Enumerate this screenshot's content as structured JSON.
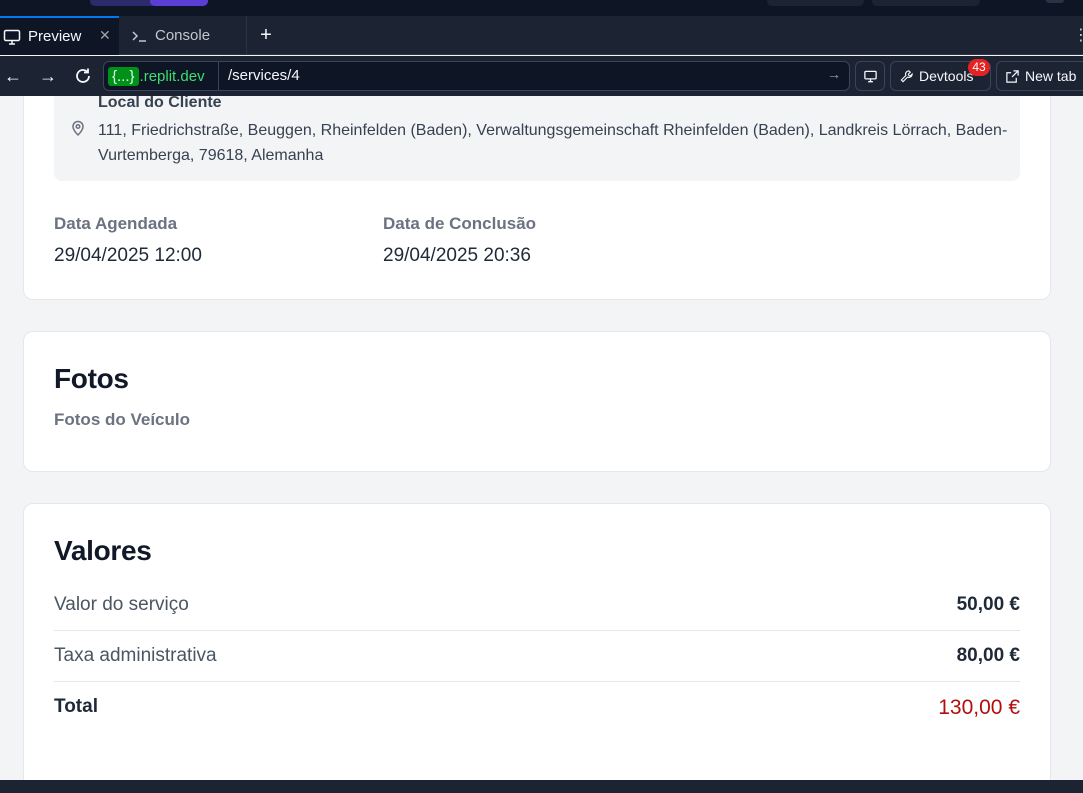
{
  "browser": {
    "tabs": [
      {
        "label": "Preview",
        "icon": "monitor-icon",
        "active": true
      },
      {
        "label": "Console",
        "icon": "terminal-icon",
        "active": false
      }
    ],
    "url": {
      "host_braces": "{...}",
      "host_domain": ".replit.dev",
      "path": "/services/4"
    },
    "devtools_label": "Devtools",
    "devtools_badge": "43",
    "new_tab_label": "New tab"
  },
  "location": {
    "label": "Local do Cliente",
    "address": "111, Friedrichstraße, Beuggen, Rheinfelden (Baden), Verwaltungsgemeinschaft Rheinfelden (Baden), Landkreis Lörrach, Baden-Vurtemberga, 79618, Alemanha"
  },
  "dates": {
    "scheduled_label": "Data Agendada",
    "scheduled_value": "29/04/2025 12:00",
    "completed_label": "Data de Conclusão",
    "completed_value": "29/04/2025 20:36"
  },
  "photos": {
    "title": "Fotos",
    "subtitle": "Fotos do Veículo"
  },
  "values": {
    "title": "Valores",
    "rows": [
      {
        "label": "Valor do serviço",
        "value": "50,00 €"
      },
      {
        "label": "Taxa administrativa",
        "value": "80,00 €"
      }
    ],
    "total_label": "Total",
    "total_value": "130,00 €",
    "total_color": "#b10f0f"
  }
}
